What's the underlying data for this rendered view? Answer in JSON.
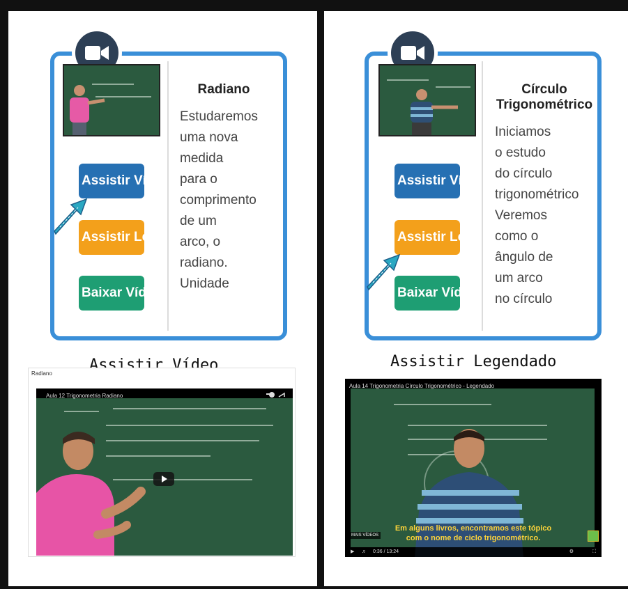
{
  "left_card": {
    "title": "Radiano",
    "text": "Estudaremos\numa nova\nmedida\npara o\ncomprimento\nde um\narco, o\nradiano.\nUnidade",
    "buttons": {
      "watch": "Assistir Vídeo",
      "subtitled": "Assistir Legendado",
      "download": "Baixar Vídeo"
    }
  },
  "left_caption": "Assistir Vídeo",
  "left_video": {
    "page_title": "Radiano",
    "title": "Aula 12 Trigonometria Radiano"
  },
  "right_card": {
    "title": "Círculo Trigonométrico",
    "text": "Iniciamos\no estudo\ndo círculo\ntrigonométrico\nVeremos\ncomo o\nângulo de\num arco\nno círculo",
    "buttons": {
      "watch": "Assistir Vídeo",
      "subtitled": "Assistir Legendado",
      "download": "Baixar Vídeo"
    }
  },
  "right_caption": "Assistir Legendado",
  "right_video": {
    "title": "Aula 14 Trigonometria Círculo Trigonométrico - Legendado",
    "subtitle_text": "Em alguns livros, encontramos este tópico\ncom o nome de ciclo trigonométrico.",
    "more_videos": "MAIS VÍDEOS",
    "time": "0:36 / 13:24"
  },
  "colors": {
    "card_border": "#3a8fd8",
    "watch_button": "#2670b3",
    "subtitled_button": "#f3a01b",
    "download_button": "#1e9e73",
    "icon_circle": "#2d3f55"
  }
}
